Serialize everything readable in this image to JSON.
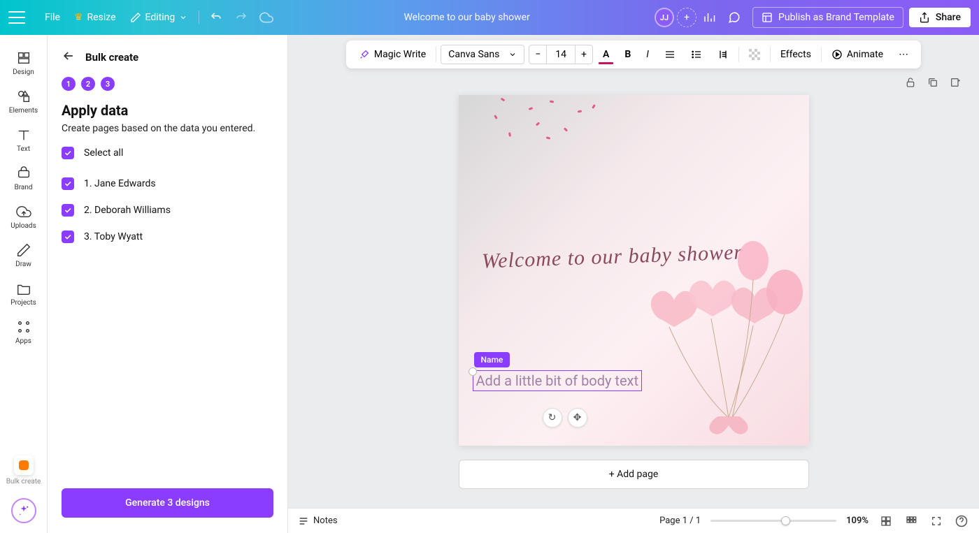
{
  "topbar": {
    "file": "File",
    "resize": "Resize",
    "editing": "Editing",
    "doc_title": "Welcome to our baby shower",
    "avatar_initials": "JJ",
    "publish_label": "Publish as Brand Template",
    "share_label": "Share"
  },
  "leftrail": {
    "items": [
      {
        "label": "Design"
      },
      {
        "label": "Elements"
      },
      {
        "label": "Text"
      },
      {
        "label": "Brand"
      },
      {
        "label": "Uploads"
      },
      {
        "label": "Draw"
      },
      {
        "label": "Projects"
      },
      {
        "label": "Apps"
      }
    ],
    "bulk_label": "Bulk create"
  },
  "sidepanel": {
    "title": "Bulk create",
    "steps": [
      "1",
      "2",
      "3"
    ],
    "heading": "Apply data",
    "description": "Create pages based on the data you entered.",
    "select_all": "Select all",
    "records": [
      {
        "label": "1. Jane Edwards"
      },
      {
        "label": "2. Deborah Williams"
      },
      {
        "label": "3. Toby Wyatt"
      }
    ],
    "generate_button": "Generate 3 designs"
  },
  "toolbar": {
    "magic_write": "Magic Write",
    "font_family": "Canva Sans",
    "font_size": "14",
    "minus": "−",
    "plus": "+",
    "effects": "Effects",
    "animate": "Animate",
    "text_color": "#c2185b"
  },
  "design": {
    "cursive_text": "Welcome to our baby shower",
    "tag_label": "Name",
    "body_placeholder": "Add a little bit of body text",
    "add_page": "+ Add page"
  },
  "bottombar": {
    "notes": "Notes",
    "page_indicator": "Page 1 / 1",
    "zoom": "109%"
  }
}
